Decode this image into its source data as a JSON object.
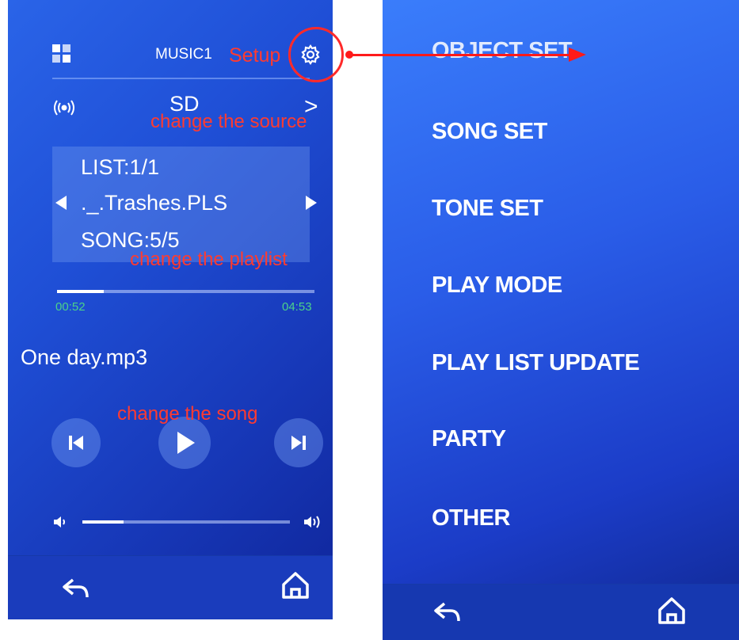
{
  "left_screen": {
    "header": {
      "apps_icon": "grid-apps-icon",
      "title": "MUSIC1",
      "settings_icon": "gear-icon"
    },
    "source": {
      "radio_icon": "radio-wave-icon",
      "label": "SD",
      "next_label": ">"
    },
    "playlist": {
      "list_label": "LIST:1/1",
      "name": "._.Trashes.PLS",
      "song_label": "SONG:5/5",
      "prev_icon": "triangle-left-icon",
      "next_icon": "triangle-right-icon"
    },
    "progress": {
      "elapsed": "00:52",
      "total": "04:53",
      "fraction": 0.18
    },
    "now_playing": "One day.mp3",
    "controls": {
      "prev_icon": "skip-previous-icon",
      "play_icon": "play-icon",
      "next_icon": "skip-next-icon"
    },
    "volume": {
      "low_icon": "volume-low-icon",
      "high_icon": "volume-high-icon",
      "fraction": 0.2
    },
    "bottom": {
      "back_icon": "back-arrow-icon",
      "home_icon": "home-icon"
    }
  },
  "annotations": {
    "setup": "Setup",
    "change_source": "change the source",
    "change_playlist": "change the playlist",
    "change_song": "change the song",
    "accent_color": "#ff2a2a"
  },
  "right_screen": {
    "menu": [
      "OBJECT SET",
      "SONG SET",
      "TONE SET",
      "PLAY MODE",
      "PLAY LIST UPDATE",
      "PARTY",
      "OTHER"
    ],
    "bottom": {
      "back_icon": "back-arrow-icon",
      "home_icon": "home-icon"
    }
  }
}
